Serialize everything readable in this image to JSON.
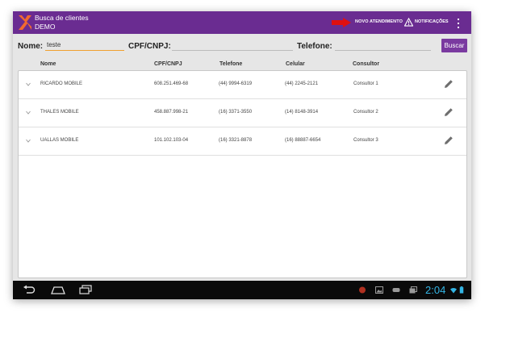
{
  "appbar": {
    "title": "Busca de clientes",
    "subtitle": "DEMO",
    "new_label": "NOVO ATENDIMENTO",
    "notif_label": "NOTIFICAÇÕES",
    "bg_color": "#6a2c91"
  },
  "search": {
    "name_label": "Nome:",
    "name_value": "teste",
    "cpf_label": "CPF/CNPJ:",
    "cpf_value": "",
    "phone_label": "Telefone:",
    "phone_value": "",
    "button_label": "Buscar"
  },
  "table": {
    "headers": [
      "Nome",
      "CPF/CNPJ",
      "Telefone",
      "Celular",
      "Consultor"
    ],
    "rows": [
      {
        "nome": "RICARDO MOBILE",
        "cpf": "608.251.469-68",
        "telefone": "(44) 9994-6319",
        "celular": "(44) 2245-2121",
        "consultor": "Consultor 1"
      },
      {
        "nome": "THALES MOBILE",
        "cpf": "458.887.998-21",
        "telefone": "(16) 3371-3550",
        "celular": "(14) 8148-3914",
        "consultor": "Consultor 2"
      },
      {
        "nome": "UALLAS MOBILE",
        "cpf": "101.102.103-04",
        "telefone": "(16) 3321-8878",
        "celular": "(16) 88887-6654",
        "consultor": "Consultor 3"
      }
    ]
  },
  "system": {
    "clock": "2:04",
    "accent": "#33b5e5"
  },
  "icons": [
    "app-logo-icon",
    "red-arrow-icon",
    "warning-icon",
    "overflow-menu-icon",
    "chevron-down-icon",
    "pencil-icon",
    "back-icon",
    "home-icon",
    "recent-apps-icon",
    "wifi-icon",
    "battery-icon"
  ]
}
